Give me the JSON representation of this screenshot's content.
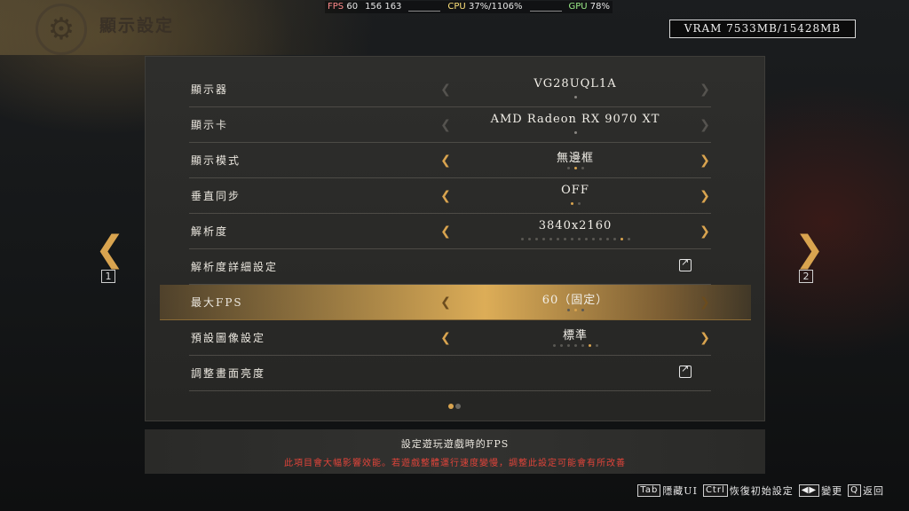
{
  "overlay": {
    "fps_label": "FPS",
    "fps_value": "60",
    "frame_value": "156 163",
    "cpu_label": "CPU",
    "cpu_value": "37%/1106%",
    "gpu_label": "GPU",
    "gpu_value": "78%"
  },
  "header": {
    "title": "顯示設定"
  },
  "vram": "VRAM 7533MB/15428MB",
  "settings": [
    {
      "label": "顯示器",
      "value": "VG28UQL1A",
      "arrows": "dim",
      "dots": 1,
      "dot_on": -1
    },
    {
      "label": "顯示卡",
      "value": "AMD Radeon RX 9070 XT",
      "arrows": "dim",
      "dots": 1,
      "dot_on": -1
    },
    {
      "label": "顯示模式",
      "value": "無邊框",
      "arrows": "lit",
      "dots": 3,
      "dot_on": 1
    },
    {
      "label": "垂直同步",
      "value": "OFF",
      "arrows": "lit",
      "dots": 2,
      "dot_on": 0
    },
    {
      "label": "解析度",
      "value": "3840x2160",
      "arrows": "lit",
      "dots": 16,
      "dot_on": 14
    },
    {
      "label": "解析度詳細設定",
      "value": "",
      "arrows": "none",
      "dots": 0,
      "dot_on": -1,
      "external": true
    },
    {
      "label": "最大FPS",
      "value": "60（固定）",
      "arrows": "sel",
      "dots": 3,
      "dot_on": 1,
      "selected": true
    },
    {
      "label": "預設圖像設定",
      "value": "標準",
      "arrows": "lit",
      "dots": 7,
      "dot_on": 5
    },
    {
      "label": "調整畫面亮度",
      "value": "",
      "arrows": "none",
      "dots": 0,
      "dot_on": -1,
      "external": true
    }
  ],
  "pages": {
    "left": "1",
    "right": "2",
    "count": 2,
    "current": 0
  },
  "description": {
    "main": "設定遊玩遊戲時的FPS",
    "warning": "此項目會大幅影響效能。若遊戲整體運行速度變慢，調整此設定可能會有所改善"
  },
  "hints": [
    {
      "key": "Tab",
      "label": "隱藏UI"
    },
    {
      "key": "Ctrl",
      "label": "恢復初始設定"
    },
    {
      "key": "◀▶",
      "label": "變更"
    },
    {
      "key": "Q",
      "label": "返回"
    }
  ],
  "colors": {
    "accent": "#d9a44f",
    "warning": "#e0443a"
  }
}
